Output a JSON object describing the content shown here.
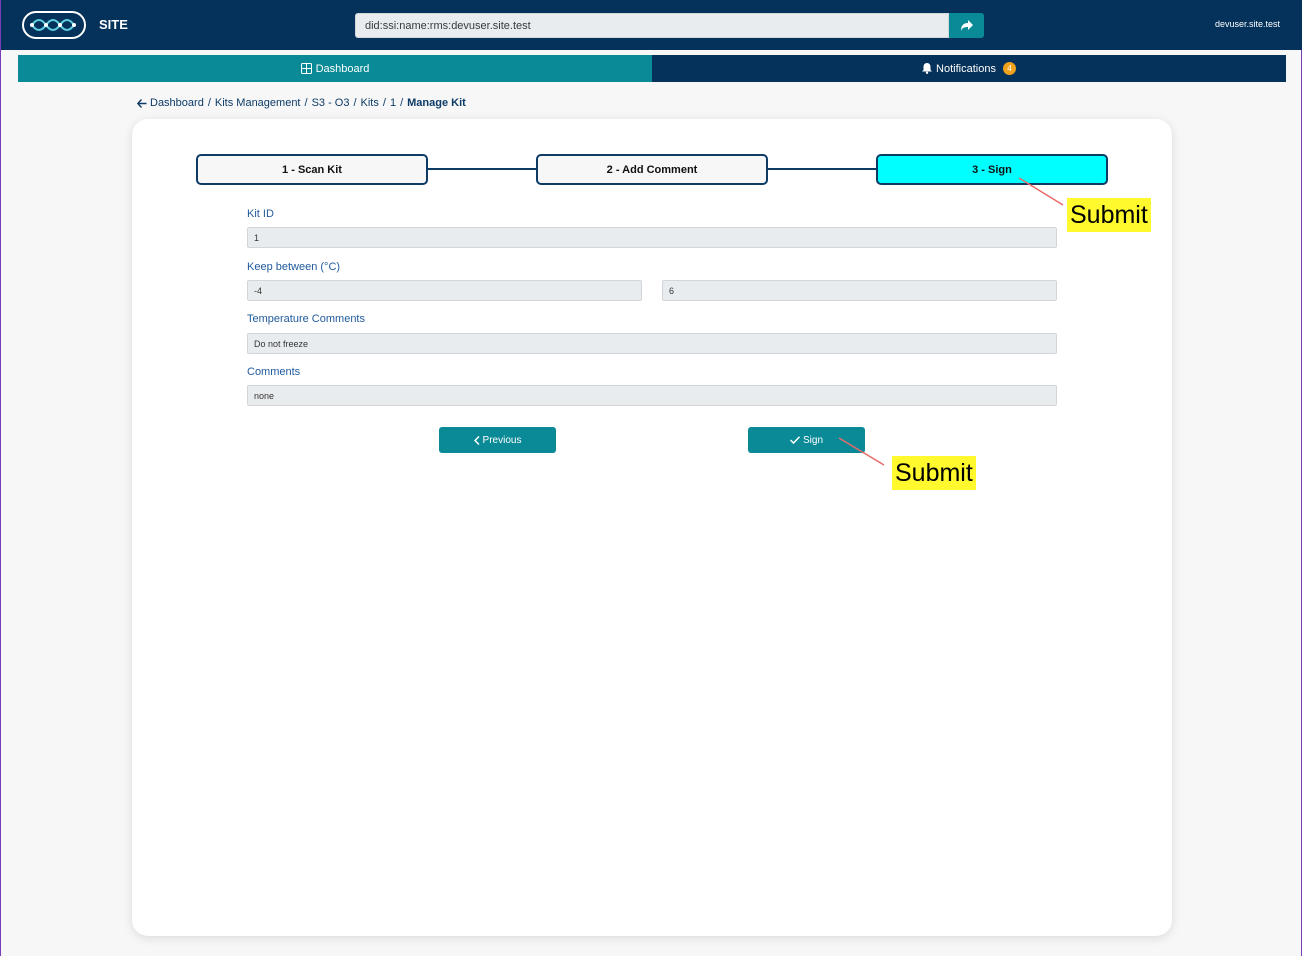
{
  "header": {
    "brand": "SITE",
    "did_value": "did:ssi:name:rms:devuser.site.test",
    "user": "devuser.site.test"
  },
  "nav": {
    "dashboard": "Dashboard",
    "notifications": "Notifications",
    "notifications_count": "4"
  },
  "breadcrumb": {
    "items": [
      "Dashboard",
      "Kits Management",
      "S3 - O3",
      "Kits",
      "1"
    ],
    "current": "Manage Kit"
  },
  "steps": [
    {
      "label": "1 - Scan Kit",
      "active": false
    },
    {
      "label": "2 - Add Comment",
      "active": false
    },
    {
      "label": "3 - Sign",
      "active": true
    }
  ],
  "form": {
    "kit_id_label": "Kit ID",
    "kit_id_value": "1",
    "keep_between_label": "Keep between (°C)",
    "keep_min": "-4",
    "keep_max": "6",
    "temp_comments_label": "Temperature Comments",
    "temp_comments_value": "Do not freeze",
    "comments_label": "Comments",
    "comments_value": "none"
  },
  "buttons": {
    "previous": "Previous",
    "sign": "Sign"
  },
  "annotations": {
    "a1": "Submit",
    "a2": "Submit"
  },
  "colors": {
    "header_bg": "#05325a",
    "accent": "#0a8a96",
    "active_step": "#00ffff",
    "badge": "#f0a31a",
    "annotation_bg": "#fff92e"
  }
}
